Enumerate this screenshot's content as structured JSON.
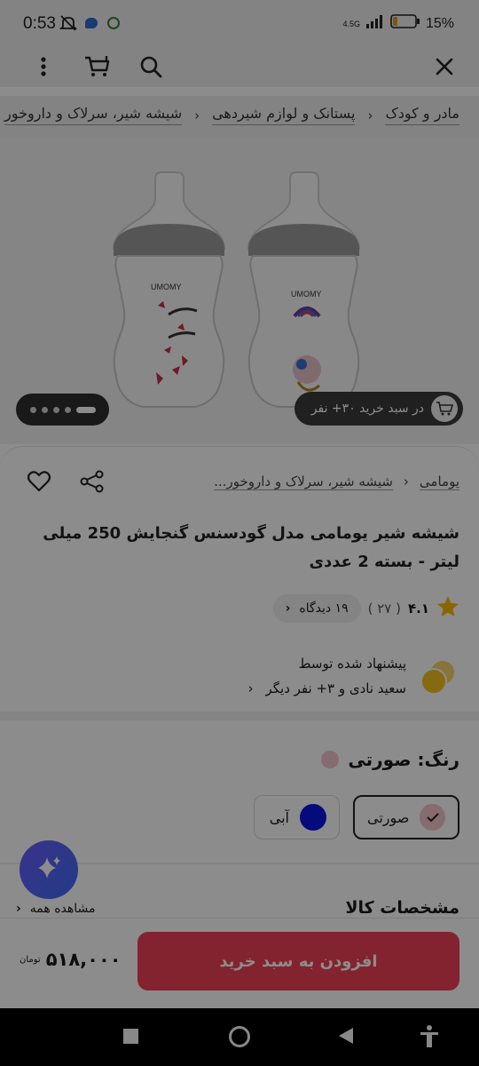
{
  "status_bar": {
    "time": "0:53",
    "network": "4.5G",
    "battery": "15%"
  },
  "breadcrumbs": [
    "مادر و کودک",
    "پستانک و لوازم شیردهی",
    "شیشه شیر، سرلاک و داروخور"
  ],
  "gallery": {
    "cart_count_text": "در سبد خرید ۳۰+ نفر",
    "image_count": 5,
    "active_index": 4,
    "bottle_brand": "UMOMY"
  },
  "product": {
    "sub_crumbs": [
      "یومامی",
      "شیشه شیر، سرلاک و داروخور..."
    ],
    "title": "شیشه شیر یومامی مدل گودسنس گنجایش 250 میلی لیتر - بسته 2 عددی",
    "rating": "۴.۱",
    "rating_count": "( ۲۷ )",
    "reviews_text": "۱۹ دیدگاه",
    "recommend_title": "پیشنهاد شده توسط",
    "recommend_names": "سعید نادی و ۳+ نفر دیگر"
  },
  "color": {
    "label": "رنگ: صورتی",
    "options": [
      {
        "name": "صورتی",
        "color": "#f4c4cd",
        "selected": true
      },
      {
        "name": "آبی",
        "color": "#0a14e0",
        "selected": false
      }
    ]
  },
  "specs": {
    "title": "مشخصات کالا",
    "see_all": "مشاهده همه"
  },
  "buy": {
    "button_label": "افزودن به سبد خرید",
    "price": "۵۱۸,۰۰۰",
    "currency": "تومان"
  },
  "colors": {
    "accent": "#ef4056",
    "fab": "#5a63f5"
  }
}
